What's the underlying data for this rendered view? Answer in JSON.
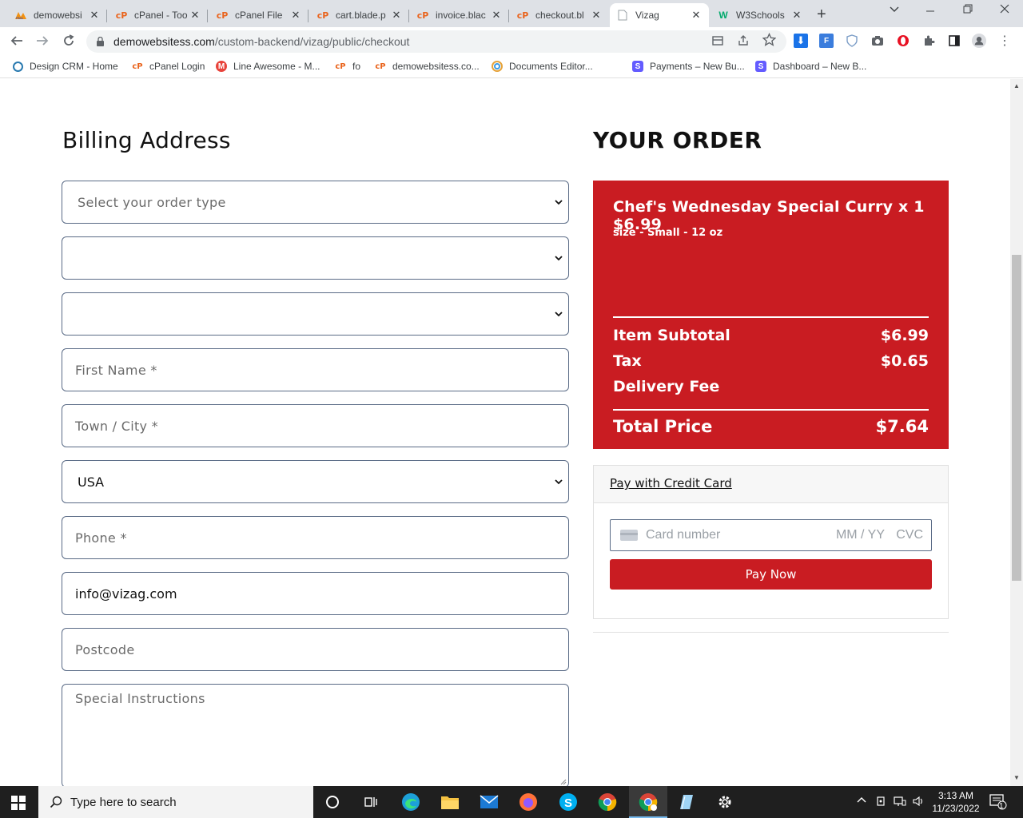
{
  "browser": {
    "tabs": [
      {
        "title": "demowebsi",
        "icon": "phpmyadmin-icon"
      },
      {
        "title": "cPanel - Too",
        "icon": "cpanel-icon"
      },
      {
        "title": "cPanel File",
        "icon": "cpanel-icon"
      },
      {
        "title": "cart.blade.p",
        "icon": "cpanel-icon"
      },
      {
        "title": "invoice.blac",
        "icon": "cpanel-icon"
      },
      {
        "title": "checkout.bl",
        "icon": "cpanel-icon"
      },
      {
        "title": "Vizag",
        "icon": "page-icon",
        "active": true
      },
      {
        "title": "W3Schools",
        "icon": "w3schools-icon"
      }
    ],
    "url_domain": "demowebsitess.com",
    "url_path": "/custom-backend/vizag/public/checkout",
    "bookmarks": [
      {
        "label": "Design CRM - Home"
      },
      {
        "label": "cPanel Login"
      },
      {
        "label": "Line Awesome - M..."
      },
      {
        "label": "fo"
      },
      {
        "label": "demowebsitess.co..."
      },
      {
        "label": "Documents Editor..."
      },
      {
        "label": "Payments – New Bu..."
      },
      {
        "label": "Dashboard – New B..."
      }
    ]
  },
  "billing": {
    "heading": "Billing Address",
    "order_type_placeholder": "Select your order type",
    "select2_value": "",
    "select3_value": "",
    "first_name_placeholder": "First Name *",
    "city_placeholder": "Town / City *",
    "country_value": "USA",
    "phone_placeholder": "Phone *",
    "email_value": "info@vizag.com",
    "postcode_placeholder": "Postcode",
    "instructions_placeholder": "Special Instructions"
  },
  "order": {
    "heading": "YOUR ORDER",
    "item_line": "Chef's Wednesday Special Curry x 1 $6.99",
    "item_size": "size - Small - 12 oz",
    "subtotal_label": "Item Subtotal",
    "subtotal_value": "$6.99",
    "tax_label": "Tax",
    "tax_value": "$0.65",
    "delivery_label": "Delivery Fee",
    "delivery_value": "",
    "total_label": "Total Price",
    "total_value": "$7.64",
    "brand_color": "#c91c22"
  },
  "payment": {
    "pay_with_label": "Pay with Credit Card",
    "card_number_placeholder": "Card number",
    "expiry_placeholder": "MM / YY",
    "cvc_placeholder": "CVC",
    "pay_button": "Pay Now"
  },
  "taskbar": {
    "search_placeholder": "Type here to search",
    "time": "3:13 AM",
    "date": "11/23/2022",
    "notification_count": "1"
  }
}
